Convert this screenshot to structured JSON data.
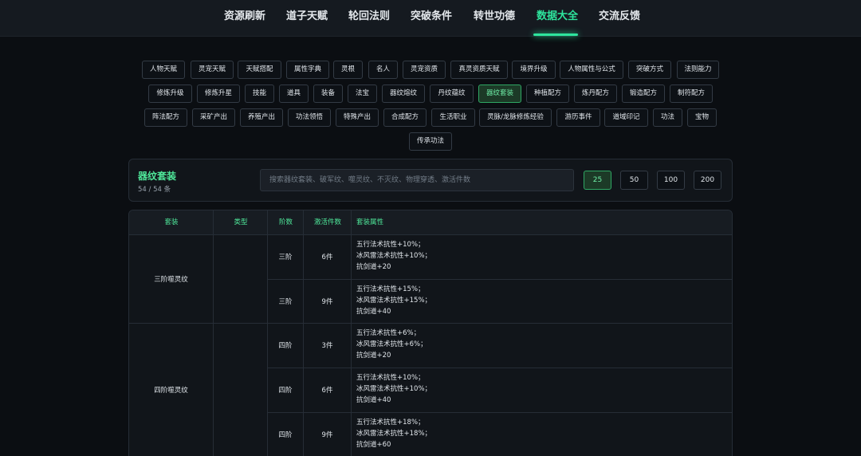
{
  "nav": {
    "items": [
      {
        "label": "资源刷新"
      },
      {
        "label": "道子天赋"
      },
      {
        "label": "轮回法则"
      },
      {
        "label": "突破条件"
      },
      {
        "label": "转世功德"
      },
      {
        "label": "数据大全"
      },
      {
        "label": "交流反馈"
      }
    ],
    "active": "数据大全"
  },
  "categories": [
    "人物天赋",
    "灵宠天赋",
    "天赋搭配",
    "属性字典",
    "灵根",
    "名人",
    "灵宠资质",
    "真灵资质天赋",
    "境界升级",
    "人物属性与公式",
    "突破方式",
    "法则能力",
    "修炼升级",
    "修炼升星",
    "技能",
    "道具",
    "装备",
    "法宝",
    "器纹熔纹",
    "丹纹蕴纹",
    "器纹套装",
    "种植配方",
    "炼丹配方",
    "锻造配方",
    "制符配方",
    "阵法配方",
    "采矿产出",
    "养殖产出",
    "功法领悟",
    "特殊产出",
    "合成配方",
    "生活职业",
    "灵脉/龙脉修炼经验",
    "游历事件",
    "道域印记",
    "功法",
    "宝物",
    "传承功法"
  ],
  "active_category": "器纹套装",
  "panel": {
    "title": "器纹套装",
    "count": "54 / 54 条",
    "search_placeholder": "搜索器纹套装、破军纹、噬灵纹、不灭纹、物理穿透、激活件数",
    "page_sizes": [
      "25",
      "50",
      "100",
      "200"
    ],
    "active_page_size": "25"
  },
  "table": {
    "headers": [
      "套装",
      "类型",
      "阶数",
      "激活件数",
      "套装属性"
    ],
    "groups": [
      {
        "suit": "三阶噬灵纹",
        "type": "",
        "rows": [
          {
            "tier": "三阶",
            "pieces": "6件",
            "attrs": [
              "五行法术抗性+10%；",
              "冰风雷法术抗性+10%；",
              "抗剑道+20"
            ]
          },
          {
            "tier": "三阶",
            "pieces": "9件",
            "attrs": [
              "五行法术抗性+15%；",
              "冰风雷法术抗性+15%；",
              "抗剑道+40"
            ]
          }
        ]
      },
      {
        "suit": "四阶噬灵纹",
        "type": "",
        "rows": [
          {
            "tier": "四阶",
            "pieces": "3件",
            "attrs": [
              "五行法术抗性+6%；",
              "冰风雷法术抗性+6%；",
              "抗剑道+20"
            ]
          },
          {
            "tier": "四阶",
            "pieces": "6件",
            "attrs": [
              "五行法术抗性+10%；",
              "冰风雷法术抗性+10%；",
              "抗剑道+40"
            ]
          },
          {
            "tier": "四阶",
            "pieces": "9件",
            "attrs": [
              "五行法术抗性+18%；",
              "冰风雷法术抗性+18%；",
              "抗剑道+60"
            ]
          }
        ]
      }
    ]
  },
  "colors": {
    "accent": "#2ee59d",
    "background": "#0b0e12",
    "panel": "#11151a",
    "border": "#262d36"
  }
}
